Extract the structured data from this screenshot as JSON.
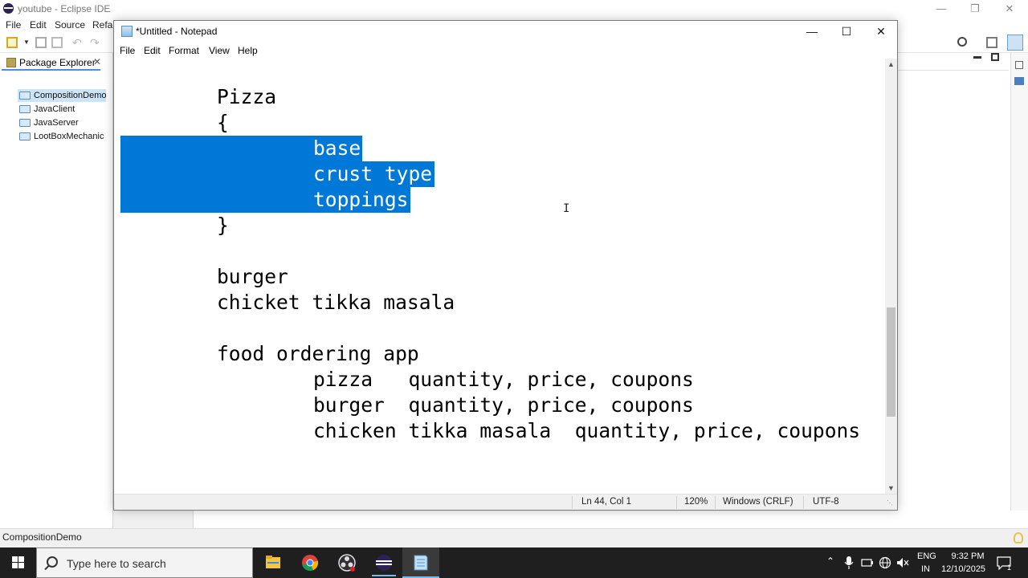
{
  "eclipse": {
    "title": "youtube - Eclipse IDE",
    "menu": [
      "File",
      "Edit",
      "Source",
      "Refac"
    ],
    "package_explorer": {
      "tab_label": "Package Explorer",
      "projects": [
        "CompositionDemo",
        "JavaClient",
        "JavaServer",
        "LootBoxMechanic"
      ],
      "selected_index": 0
    },
    "status_text": "CompositionDemo"
  },
  "notepad": {
    "title": "*Untitled - Notepad",
    "menu": [
      "File",
      "Edit",
      "Format",
      "View",
      "Help"
    ],
    "lines": [
      "Pizza",
      "{",
      "base",
      "crust type",
      "toppings",
      "}",
      "burger",
      "chicket tikka masala",
      "food ordering app",
      "pizza   quantity, price, coupons",
      "burger  quantity, price, coupons",
      "chicken tikka masala  quantity, price, coupons"
    ],
    "selected_lines": [
      2,
      3,
      4
    ],
    "status": {
      "position": "Ln 44, Col 1",
      "zoom": "120%",
      "line_ending": "Windows (CRLF)",
      "encoding": "UTF-8"
    },
    "scroll_position": 0.65
  },
  "taskbar": {
    "search_placeholder": "Type here to search",
    "apps": [
      "file-explorer-icon",
      "chrome-icon",
      "obs-icon",
      "eclipse-icon",
      "notepad-icon"
    ],
    "active_app": "notepad-icon",
    "lang_top": "ENG",
    "lang_bottom": "IN",
    "time": "9:32 PM",
    "date": "12/10/2025",
    "notification_count": "1"
  },
  "colors": {
    "selection": "#0078d7",
    "taskbar": "#1f1f1f",
    "project_selected": "#cce4f7"
  }
}
